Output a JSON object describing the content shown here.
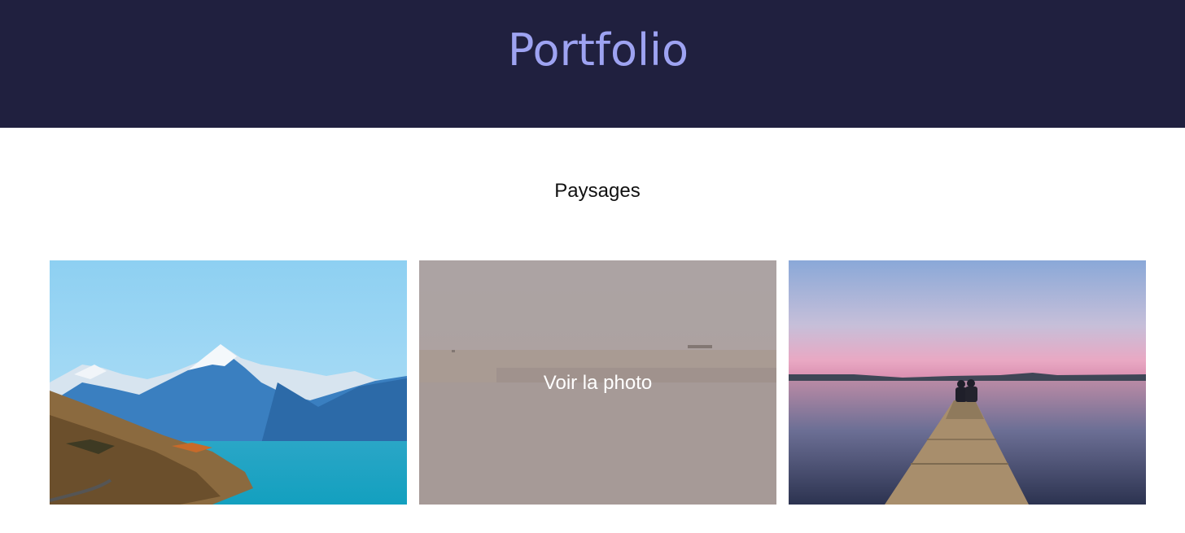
{
  "header": {
    "title": "Portfolio",
    "background": "#20203f",
    "title_color": "#9ea3f2"
  },
  "section": {
    "title": "Paysages"
  },
  "gallery": {
    "photos": [
      {
        "subject": "mountain lake with snowy peaks",
        "hover_label": ""
      },
      {
        "subject": "calm sea with sandbank at dusk",
        "hover_label": "Voir la photo"
      },
      {
        "subject": "couple sitting on wooden pier at sunset",
        "hover_label": ""
      }
    ]
  }
}
